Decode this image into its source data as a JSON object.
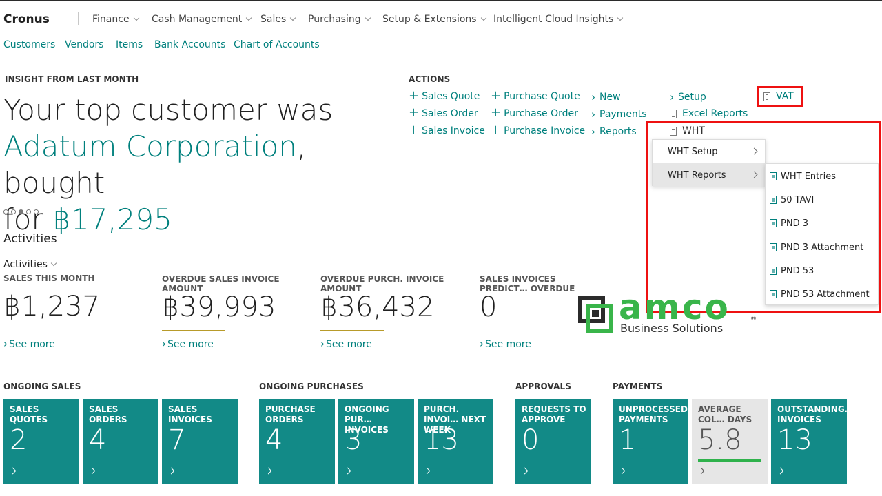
{
  "brand": "Cronus",
  "nav": [
    "Finance",
    "Cash Management",
    "Sales",
    "Purchasing",
    "Setup & Extensions",
    "Intelligent Cloud Insights"
  ],
  "sub_nav": [
    "Customers",
    "Vendors",
    "Items",
    "Bank Accounts",
    "Chart of Accounts"
  ],
  "insight": {
    "caption": "INSIGHT FROM LAST MONTH",
    "line1": "Your top customer was",
    "customer": "Adatum Corporation",
    "mid": ", bought",
    "for": "for ",
    "amount": "฿17,295",
    "slide_count": 5,
    "active_slide": 3
  },
  "actions": {
    "caption": "ACTIONS",
    "col1": [
      "Sales Quote",
      "Sales Order",
      "Sales Invoice"
    ],
    "col2": [
      "Purchase Quote",
      "Purchase Order",
      "Purchase Invoice"
    ],
    "col3": [
      "New",
      "Payments",
      "Reports"
    ],
    "col4": [
      "Setup",
      "Excel Reports",
      "WHT"
    ],
    "vat": "VAT"
  },
  "wht_menu": {
    "items": [
      "WHT Setup",
      "WHT Reports"
    ],
    "selected": "WHT Reports",
    "reports": [
      "WHT Entries",
      "50 TAVI",
      "PND 3",
      "PND 3 Attachment",
      "PND 53",
      "PND 53 Attachment"
    ]
  },
  "activities": {
    "title": "Activities",
    "group": "Activities",
    "see_more": "See more",
    "kpis": [
      {
        "label": "SALES THIS MONTH",
        "value": "฿1,237",
        "bar_color": ""
      },
      {
        "label": "OVERDUE SALES INVOICE AMOUNT",
        "value": "฿39,993",
        "bar_color": "#b89b2a"
      },
      {
        "label": "OVERDUE PURCH. INVOICE AMOUNT",
        "value": "฿36,432",
        "bar_color": "#b89b2a"
      },
      {
        "label": "SALES INVOICES PREDICT… OVERDUE",
        "value": "0",
        "bar_color": "#c8c8c8"
      }
    ]
  },
  "logo": {
    "word": "amco",
    "sub": "Business Solutions",
    "mark": "®"
  },
  "groups": {
    "ongoing_sales": "ONGOING SALES",
    "ongoing_purchases": "ONGOING PURCHASES",
    "approvals": "APPROVALS",
    "payments": "PAYMENTS"
  },
  "tiles": [
    {
      "label": "SALES QUOTES",
      "value": "2"
    },
    {
      "label": "SALES ORDERS",
      "value": "4"
    },
    {
      "label": "SALES INVOICES",
      "value": "7"
    },
    {
      "label": "PURCHASE ORDERS",
      "value": "4"
    },
    {
      "label": "ONGOING PUR… INVOICES",
      "value": "3"
    },
    {
      "label": "PURCH. INVOI… NEXT WEEK",
      "value": "13"
    },
    {
      "label": "REQUESTS TO APPROVE",
      "value": "0"
    },
    {
      "label": "UNPROCESSED PAYMENTS",
      "value": "1"
    },
    {
      "label": "AVERAGE COL… DAYS",
      "value": "5.8"
    },
    {
      "label": "OUTSTANDING… INVOICES",
      "value": "13"
    }
  ],
  "colors": {
    "accent": "#00807d",
    "tile": "#128a87",
    "highlight_box": "#e11111",
    "logo_green": "#39b54a"
  }
}
